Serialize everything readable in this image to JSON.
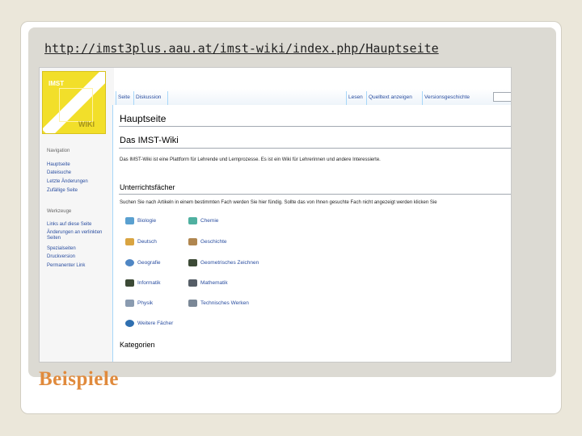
{
  "slide": {
    "url": "http://imst3plus.aau.at/imst-wiki/index.php/Hauptseite",
    "title": "Beispiele"
  },
  "wiki": {
    "logo_top": "IMST",
    "logo_bottom": "WIKI",
    "sidebar": {
      "nav_heading": "Navigation",
      "nav_items": [
        "Hauptseite",
        "Dateisuche",
        "Letzte Änderungen",
        "Zufällige Seite"
      ],
      "tools_heading": "Werkzeuge",
      "tool_items": [
        "Links auf diese Seite",
        "Änderungen an verlinkten Seiten",
        "Spezialseiten",
        "Druckversion",
        "Permanenter Link"
      ]
    },
    "tabs_left": [
      "Seite",
      "Diskussion"
    ],
    "tabs_right": [
      "Lesen",
      "Quelltext anzeigen",
      "Versionsgeschichte"
    ],
    "page_title": "Hauptseite",
    "heading": "Das IMST-Wiki",
    "intro": "Das IMST-Wiki ist eine Plattform für Lehrende und Lernprozesse. Es ist ein Wiki für Lehrerinnen und andere Interessierte.",
    "section_heading": "Unterrichtsfächer",
    "section_hint": "Suchen Sie nach Artikeln in einem bestimmten Fach werden Sie hier fündig. Sollte das von Ihnen gesuchte Fach nicht angezeigt werden klicken Sie",
    "subjects_left": [
      "Biologie",
      "Deutsch",
      "Geografie",
      "Informatik",
      "Physik",
      "Weitere Fächer"
    ],
    "subjects_right": [
      "Chemie",
      "Geschichte",
      "Geometrisches Zeichnen",
      "Mathematik",
      "Technisches Werken"
    ],
    "categories_heading": "Kategorien"
  },
  "colors": {
    "title_orange": "#e08a3c",
    "link_blue": "#2a4ea0",
    "logo_yellow": "#f2df2a"
  }
}
